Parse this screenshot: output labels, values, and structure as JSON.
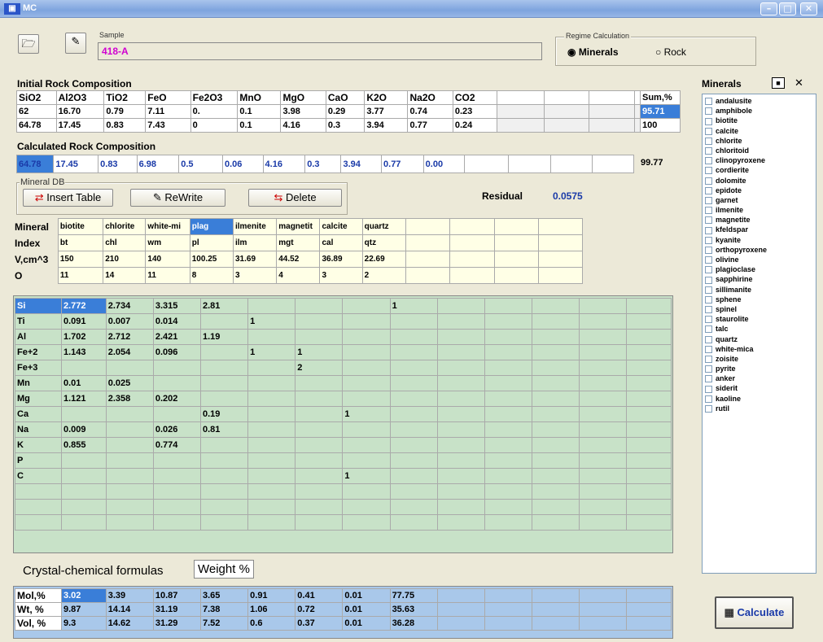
{
  "window": {
    "title": "MC"
  },
  "sample": {
    "label": "Sample",
    "value": "418-A"
  },
  "regime": {
    "label": "Regime Calculation",
    "options": [
      {
        "label": "Minerals",
        "selected": true
      },
      {
        "label": "Rock",
        "selected": false
      }
    ]
  },
  "initial": {
    "title": "Initial Rock Composition",
    "headers": [
      "SiO2",
      "Al2O3",
      "TiO2",
      "FeO",
      "Fe2O3",
      "MnO",
      "MgO",
      "CaO",
      "K2O",
      "Na2O",
      "CO2",
      "",
      "",
      "",
      ""
    ],
    "row1": [
      "62",
      "16.70",
      "0.79",
      "7.11",
      "0.",
      "0.1",
      "3.98",
      "0.29",
      "3.77",
      "0.74",
      "0.23",
      "",
      "",
      "",
      ""
    ],
    "row2": [
      "64.78",
      "17.45",
      "0.83",
      "7.43",
      "0",
      "0.1",
      "4.16",
      "0.3",
      "3.94",
      "0.77",
      "0.24",
      "",
      "",
      "",
      ""
    ],
    "sum_header": "Sum,%",
    "sum1": "95.71",
    "sum2": "100"
  },
  "calculated": {
    "title": "Calculated Rock Composition",
    "row": [
      "64.78",
      "17.45",
      "0.83",
      "6.98",
      "0.5",
      "0.06",
      "4.16",
      "0.3",
      "3.94",
      "0.77",
      "0.00",
      "",
      "",
      "",
      ""
    ],
    "sum": "99.77"
  },
  "mineral_db": {
    "label": "Mineral DB",
    "insert": "Insert Table",
    "rewrite": "ReWrite",
    "delete": "Delete"
  },
  "residual": {
    "label": "Residual",
    "value": "0.0575"
  },
  "mineral_table": {
    "rows": [
      {
        "label": "Mineral",
        "cells": [
          "biotite",
          "chlorite",
          "white-mi",
          "plag",
          "ilmenite",
          "magnetit",
          "calcite",
          "quartz",
          "",
          "",
          "",
          ""
        ]
      },
      {
        "label": "Index",
        "cells": [
          "bt",
          "chl",
          "wm",
          "pl",
          "ilm",
          "mgt",
          "cal",
          "qtz",
          "",
          "",
          "",
          ""
        ]
      },
      {
        "label": "V,cm^3",
        "cells": [
          "150",
          "210",
          "140",
          "100.25",
          "31.69",
          "44.52",
          "36.89",
          "22.69",
          "",
          "",
          "",
          ""
        ]
      },
      {
        "label": "O",
        "cells": [
          "11",
          "14",
          "11",
          "8",
          "3",
          "4",
          "3",
          "2",
          "",
          "",
          "",
          ""
        ]
      }
    ]
  },
  "formula_table": {
    "rows": [
      {
        "label": "Si",
        "cells": [
          "2.772",
          "2.734",
          "3.315",
          "2.81",
          "",
          "",
          "",
          "1",
          "",
          "",
          "",
          "",
          ""
        ]
      },
      {
        "label": "Ti",
        "cells": [
          "0.091",
          "0.007",
          "0.014",
          "",
          "1",
          "",
          "",
          "",
          "",
          "",
          "",
          "",
          ""
        ]
      },
      {
        "label": "Al",
        "cells": [
          "1.702",
          "2.712",
          "2.421",
          "1.19",
          "",
          "",
          "",
          "",
          "",
          "",
          "",
          "",
          ""
        ]
      },
      {
        "label": "Fe+2",
        "cells": [
          "1.143",
          "2.054",
          "0.096",
          "",
          "1",
          "1",
          "",
          "",
          "",
          "",
          "",
          "",
          ""
        ]
      },
      {
        "label": "Fe+3",
        "cells": [
          "",
          "",
          "",
          "",
          "",
          "2",
          "",
          "",
          "",
          "",
          "",
          "",
          ""
        ]
      },
      {
        "label": "Mn",
        "cells": [
          "0.01",
          "0.025",
          "",
          "",
          "",
          "",
          "",
          "",
          "",
          "",
          "",
          "",
          ""
        ]
      },
      {
        "label": "Mg",
        "cells": [
          "1.121",
          "2.358",
          "0.202",
          "",
          "",
          "",
          "",
          "",
          "",
          "",
          "",
          "",
          ""
        ]
      },
      {
        "label": "Ca",
        "cells": [
          "",
          "",
          "",
          "0.19",
          "",
          "",
          "1",
          "",
          "",
          "",
          "",
          "",
          ""
        ]
      },
      {
        "label": "Na",
        "cells": [
          "0.009",
          "",
          "0.026",
          "0.81",
          "",
          "",
          "",
          "",
          "",
          "",
          "",
          "",
          ""
        ]
      },
      {
        "label": "K",
        "cells": [
          "0.855",
          "",
          "0.774",
          "",
          "",
          "",
          "",
          "",
          "",
          "",
          "",
          "",
          ""
        ]
      },
      {
        "label": "P",
        "cells": [
          "",
          "",
          "",
          "",
          "",
          "",
          "",
          "",
          "",
          "",
          "",
          "",
          ""
        ]
      },
      {
        "label": "C",
        "cells": [
          "",
          "",
          "",
          "",
          "",
          "",
          "1",
          "",
          "",
          "",
          "",
          "",
          ""
        ]
      },
      {
        "label": "",
        "cells": [
          "",
          "",
          "",
          "",
          "",
          "",
          "",
          "",
          "",
          "",
          "",
          "",
          ""
        ]
      },
      {
        "label": "",
        "cells": [
          "",
          "",
          "",
          "",
          "",
          "",
          "",
          "",
          "",
          "",
          "",
          "",
          ""
        ]
      },
      {
        "label": "",
        "cells": [
          "",
          "",
          "",
          "",
          "",
          "",
          "",
          "",
          "",
          "",
          "",
          "",
          ""
        ]
      }
    ]
  },
  "tabs": {
    "formulas": "Crystal-chemical formulas",
    "weight": "Weight %"
  },
  "results": {
    "rows": [
      {
        "label": "Mol,%",
        "cells": [
          "3.02",
          "3.39",
          "10.87",
          "3.65",
          "0.91",
          "0.41",
          "0.01",
          "77.75",
          "",
          "",
          "",
          "",
          ""
        ]
      },
      {
        "label": "Wt, %",
        "cells": [
          "9.87",
          "14.14",
          "31.19",
          "7.38",
          "1.06",
          "0.72",
          "0.01",
          "35.63",
          "",
          "",
          "",
          "",
          ""
        ]
      },
      {
        "label": "Vol, %",
        "cells": [
          "9.3",
          "14.62",
          "31.29",
          "7.52",
          "0.6",
          "0.37",
          "0.01",
          "36.28",
          "",
          "",
          "",
          "",
          ""
        ]
      }
    ]
  },
  "minerals_panel": {
    "title": "Minerals",
    "items": [
      "andalusite",
      "amphibole",
      "biotite",
      "calcite",
      "chlorite",
      "chloritoid",
      "clinopyroxene",
      "cordierite",
      "dolomite",
      "epidote",
      "garnet",
      "ilmenite",
      "magnetite",
      "kfeldspar",
      "kyanite",
      "orthopyroxene",
      "olivine",
      "plagioclase",
      "sapphirine",
      "sillimanite",
      "sphene",
      "spinel",
      "staurolite",
      "talc",
      "quartz",
      "white-mica",
      "zoisite",
      "pyrite",
      "anker",
      "siderit",
      "kaoline",
      "rutil"
    ]
  },
  "calculate": {
    "label": "Calculate"
  }
}
